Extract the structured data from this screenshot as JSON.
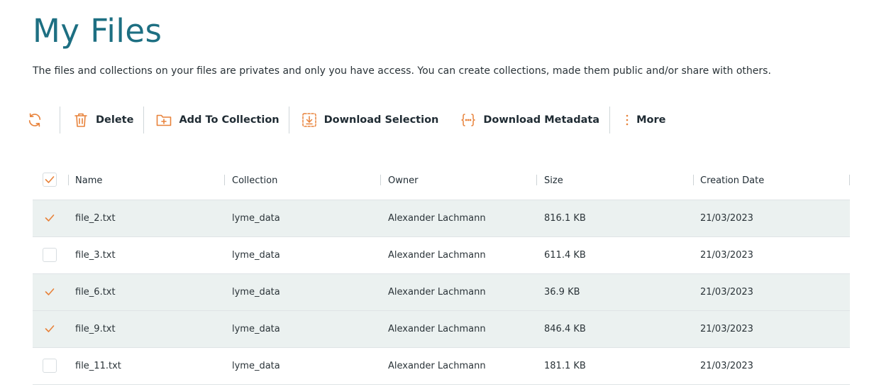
{
  "page": {
    "title": "My Files",
    "description": "The files and collections on your files are privates and only you have access. You can create collections, made them public and/or share with others."
  },
  "toolbar": {
    "refresh_icon": "refresh-icon",
    "delete_label": "Delete",
    "add_to_collection_label": "Add To Collection",
    "download_selection_label": "Download Selection",
    "download_metadata_label": "Download Metadata",
    "more_label": "More"
  },
  "colors": {
    "title": "#1d6f82",
    "accent": "#e8823a",
    "selected_row": "#ebf1f0",
    "text": "#1f2b33"
  },
  "table": {
    "header_checkbox_checked": true,
    "columns": [
      "Name",
      "Collection",
      "Owner",
      "Size",
      "Creation Date"
    ],
    "rows": [
      {
        "selected": true,
        "name": "file_2.txt",
        "collection": "lyme_data",
        "owner": "Alexander Lachmann",
        "size": "816.1 KB",
        "date": "21/03/2023"
      },
      {
        "selected": false,
        "name": "file_3.txt",
        "collection": "lyme_data",
        "owner": "Alexander Lachmann",
        "size": "611.4 KB",
        "date": "21/03/2023"
      },
      {
        "selected": true,
        "name": "file_6.txt",
        "collection": "lyme_data",
        "owner": "Alexander Lachmann",
        "size": "36.9 KB",
        "date": "21/03/2023"
      },
      {
        "selected": true,
        "name": "file_9.txt",
        "collection": "lyme_data",
        "owner": "Alexander Lachmann",
        "size": "846.4 KB",
        "date": "21/03/2023"
      },
      {
        "selected": false,
        "name": "file_11.txt",
        "collection": "lyme_data",
        "owner": "Alexander Lachmann",
        "size": "181.1 KB",
        "date": "21/03/2023"
      }
    ]
  }
}
